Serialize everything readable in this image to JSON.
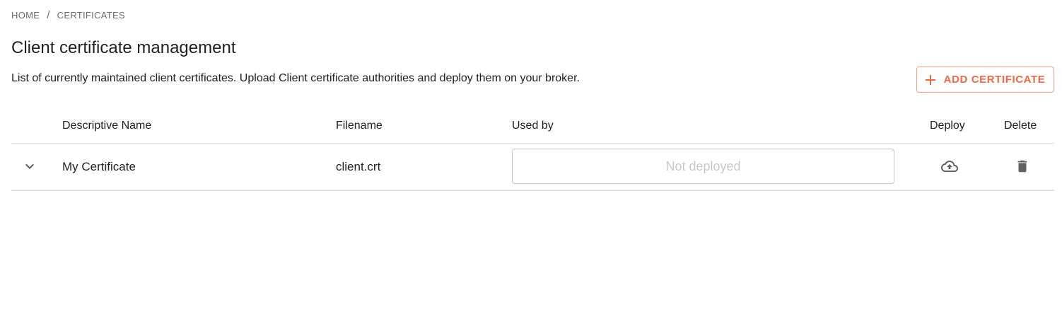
{
  "breadcrumb": {
    "home": "HOME",
    "separator": "/",
    "current": "CERTIFICATES"
  },
  "page": {
    "title": "Client certificate management",
    "description": "List of currently maintained client certificates. Upload Client certificate authorities and deploy them on your broker."
  },
  "actions": {
    "add_certificate_label": "ADD CERTIFICATE",
    "add_icon": "plus-icon"
  },
  "table": {
    "columns": {
      "name": "Descriptive Name",
      "filename": "Filename",
      "used_by": "Used by",
      "deploy": "Deploy",
      "delete": "Delete"
    },
    "rows": [
      {
        "name": "My Certificate",
        "filename": "client.crt",
        "used_by_placeholder": "Not deployed",
        "expand_icon": "chevron-down-icon",
        "deploy_icon": "cloud-upload-icon",
        "delete_icon": "trash-icon"
      }
    ]
  },
  "colors": {
    "accent": "#ee6847",
    "accent_border": "#f2a08c",
    "text": "#212121",
    "muted": "#6b6b6b",
    "icon": "#616161",
    "divider": "#e0e0e0"
  }
}
